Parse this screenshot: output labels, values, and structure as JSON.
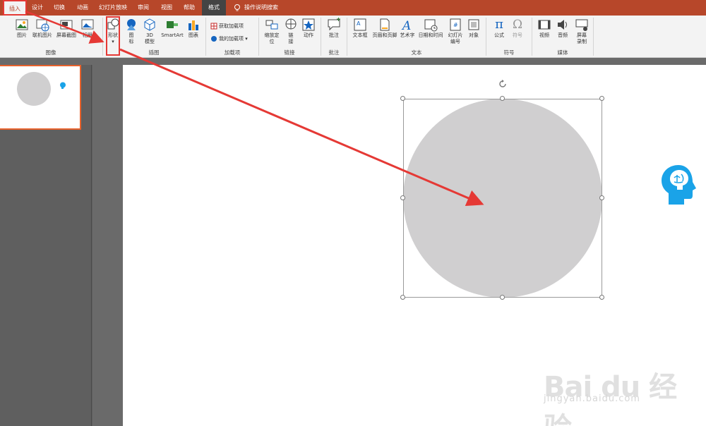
{
  "tabs": [
    {
      "label": "插入",
      "state": "active"
    },
    {
      "label": "设计"
    },
    {
      "label": "切换"
    },
    {
      "label": "动画"
    },
    {
      "label": "幻灯片放映"
    },
    {
      "label": "审阅"
    },
    {
      "label": "视图"
    },
    {
      "label": "帮助"
    },
    {
      "label": "格式",
      "state": "format"
    }
  ],
  "tell_me": "操作说明搜索",
  "groups": {
    "images": "图像",
    "illustrations": "插图",
    "addins": "加载项",
    "links": "链接",
    "comments": "批注",
    "text": "文本",
    "symbols": "符号",
    "media": "媒体"
  },
  "buttons": {
    "picture": "图片",
    "online_picture": "联机图片",
    "screenshot": "屏幕截图",
    "album": "相册",
    "shapes": "形状",
    "icons_1": "图",
    "icons_2": "标",
    "model_1": "3D",
    "model_2": "模型",
    "smartart": "SmartArt",
    "chart": "图表",
    "get_addins": "获取加载项",
    "my_addins": "我的加载项",
    "zoom_1": "缩放定",
    "zoom_2": "位",
    "link_1": "链",
    "link_2": "接",
    "action": "动作",
    "comment": "批注",
    "textbox": "文本框",
    "header_footer": "页眉和页脚",
    "wordart": "艺术字",
    "datetime": "日期和时间",
    "slide_num_1": "幻灯片",
    "slide_num_2": "编号",
    "object": "对象",
    "equation": "公式",
    "symbol": "符号",
    "video": "视频",
    "audio": "音频",
    "screen_rec_1": "屏幕",
    "screen_rec_2": "录制"
  },
  "glyphs": {
    "pi": "π",
    "omega": "Ω"
  },
  "watermark": {
    "logo": "Bai du 经验",
    "url": "jingyan.baidu.com"
  },
  "colors": {
    "accent": "#b7472a",
    "highlight": "#e53935",
    "circle": "#d0cfd0",
    "head_icon": "#1aa3e8"
  }
}
